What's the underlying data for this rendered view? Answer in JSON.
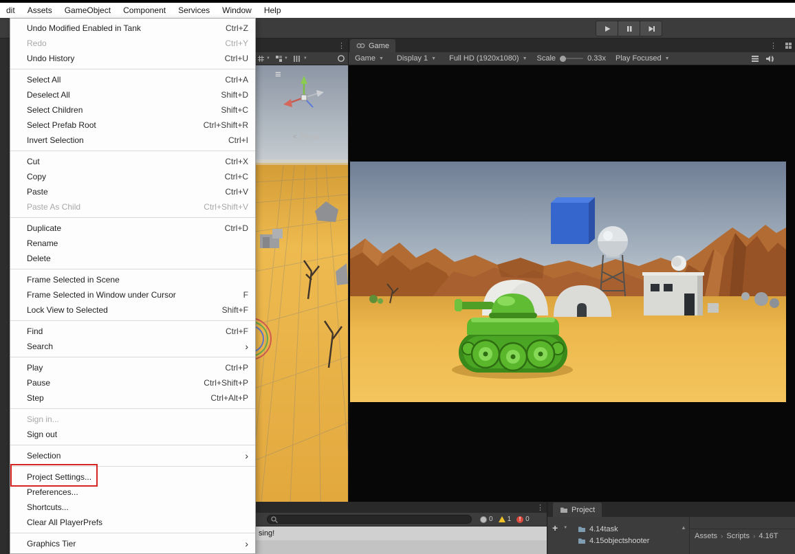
{
  "menubar": {
    "items": [
      "dit",
      "Assets",
      "GameObject",
      "Component",
      "Services",
      "Window",
      "Help"
    ]
  },
  "edit_menu": {
    "items": [
      {
        "label": "Undo Modified Enabled in Tank",
        "shortcut": "Ctrl+Z"
      },
      {
        "label": "Redo",
        "shortcut": "Ctrl+Y",
        "disabled": true
      },
      {
        "label": "Undo History",
        "shortcut": "Ctrl+U"
      },
      {
        "label": "Select All",
        "shortcut": "Ctrl+A"
      },
      {
        "label": "Deselect All",
        "shortcut": "Shift+D"
      },
      {
        "label": "Select Children",
        "shortcut": "Shift+C"
      },
      {
        "label": "Select Prefab Root",
        "shortcut": "Ctrl+Shift+R"
      },
      {
        "label": "Invert Selection",
        "shortcut": "Ctrl+I"
      },
      {
        "label": "Cut",
        "shortcut": "Ctrl+X"
      },
      {
        "label": "Copy",
        "shortcut": "Ctrl+C"
      },
      {
        "label": "Paste",
        "shortcut": "Ctrl+V"
      },
      {
        "label": "Paste As Child",
        "shortcut": "Ctrl+Shift+V",
        "disabled": true
      },
      {
        "label": "Duplicate",
        "shortcut": "Ctrl+D"
      },
      {
        "label": "Rename",
        "shortcut": ""
      },
      {
        "label": "Delete",
        "shortcut": ""
      },
      {
        "label": "Frame Selected in Scene",
        "shortcut": ""
      },
      {
        "label": "Frame Selected in Window under Cursor",
        "shortcut": "F"
      },
      {
        "label": "Lock View to Selected",
        "shortcut": "Shift+F"
      },
      {
        "label": "Find",
        "shortcut": "Ctrl+F"
      },
      {
        "label": "Search",
        "submenu": true
      },
      {
        "label": "Play",
        "shortcut": "Ctrl+P"
      },
      {
        "label": "Pause",
        "shortcut": "Ctrl+Shift+P"
      },
      {
        "label": "Step",
        "shortcut": "Ctrl+Alt+P"
      },
      {
        "label": "Sign in...",
        "disabled": true
      },
      {
        "label": "Sign out",
        "shortcut": ""
      },
      {
        "label": "Selection",
        "submenu": true
      },
      {
        "label": "Project Settings...",
        "shortcut": "",
        "annotated": true
      },
      {
        "label": "Preferences...",
        "shortcut": ""
      },
      {
        "label": "Shortcuts...",
        "shortcut": ""
      },
      {
        "label": "Clear All PlayerPrefs",
        "shortcut": ""
      },
      {
        "label": "Graphics Tier",
        "submenu": true
      }
    ]
  },
  "icons": {
    "submenu_arrow": "›",
    "dropdown_arrow": "▼",
    "kebab": "⋮",
    "hamburger": "≡",
    "scroll_up": "▲",
    "plus": "+",
    "breadcrumb_separator": "›",
    "persp_toggle": "<",
    "error_mark": "!"
  },
  "scene_panel": {
    "persp_label": "Persp"
  },
  "game_panel": {
    "tab": "Game",
    "aspect_dropdown": "Game",
    "display": "Display 1",
    "resolution": "Full HD (1920x1080)",
    "scale_label": "Scale",
    "scale_value": "0.33x",
    "focus_mode": "Play Focused"
  },
  "console": {
    "message": "sing!",
    "log_count": "0",
    "warning_count": "1",
    "error_count": "0"
  },
  "project": {
    "tab": "Project",
    "folders": [
      "4.14task",
      "4.15objectshooter"
    ],
    "breadcrumb": [
      "Assets",
      "Scripts",
      "4.16T"
    ]
  },
  "colors": {
    "accent_red": "#d62422",
    "sand": "#eeb94e",
    "tank_green": "#5ab72c",
    "cube_blue": "#3566cd"
  }
}
